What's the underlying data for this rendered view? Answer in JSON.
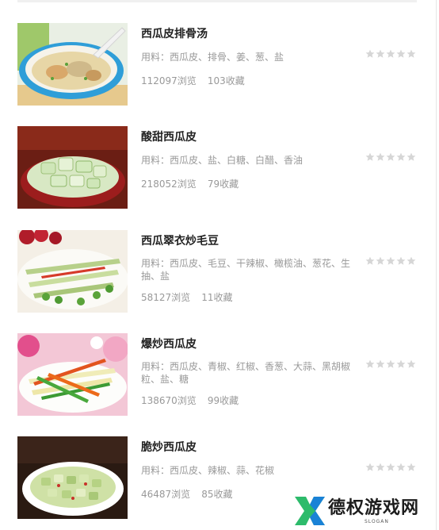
{
  "recipes": [
    {
      "title": "西瓜皮排骨汤",
      "ingredients": "用料：西瓜皮、排骨、姜、葱、盐",
      "views": "112097浏览",
      "favorites": "103收藏",
      "rating_stars": 0
    },
    {
      "title": "酸甜西瓜皮",
      "ingredients": "用料：西瓜皮、盐、白糖、白醋、香油",
      "views": "218052浏览",
      "favorites": "79收藏",
      "rating_stars": 0
    },
    {
      "title": "西瓜翠衣炒毛豆",
      "ingredients": "用料：西瓜皮、毛豆、干辣椒、橄榄油、葱花、生抽、盐",
      "views": "58127浏览",
      "favorites": "11收藏",
      "rating_stars": 0
    },
    {
      "title": "爆炒西瓜皮",
      "ingredients": "用料：西瓜皮、青椒、红椒、香葱、大蒜、黑胡椒粒、盐、糖",
      "views": "138670浏览",
      "favorites": "99收藏",
      "rating_stars": 0
    },
    {
      "title": "脆炒西瓜皮",
      "ingredients": "用料：西瓜皮、辣椒、蒜、花椒",
      "views": "46487浏览",
      "favorites": "85收藏",
      "rating_stars": 0
    }
  ],
  "watermark": {
    "text": "德权游戏网",
    "slogan": "SLOGAN"
  },
  "colors": {
    "title": "#222222",
    "meta": "#999999",
    "star_empty": "#d6d6d6",
    "logo_green": "#2dbb6b",
    "logo_blue": "#1a82d6"
  },
  "icons": {
    "rating": "star-icon",
    "watermark": "site-logo-icon"
  }
}
